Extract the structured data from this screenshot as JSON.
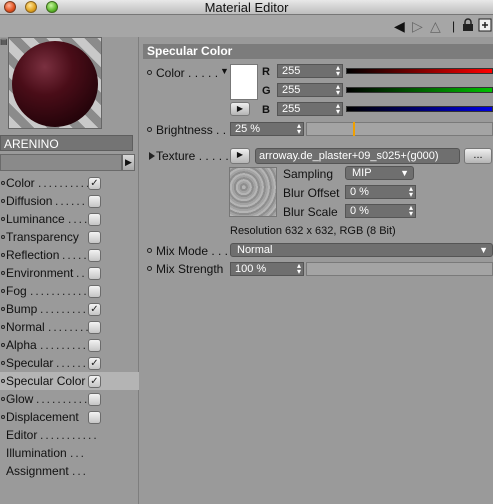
{
  "window": {
    "title": "Material Editor"
  },
  "toolbar": {
    "back_icon": "arrow-left-icon",
    "forward_icon": "arrow-right-icon",
    "up_icon": "arrow-up-icon",
    "lock_icon": "lock-icon",
    "new_icon": "new-panel-icon"
  },
  "material": {
    "name": "ARENINO",
    "accent": "#5a1320"
  },
  "channels": [
    {
      "label": "Color",
      "checked": true,
      "has_checkbox": true
    },
    {
      "label": "Diffusion",
      "checked": false,
      "has_checkbox": true
    },
    {
      "label": "Luminance",
      "checked": false,
      "has_checkbox": true
    },
    {
      "label": "Transparency",
      "checked": false,
      "has_checkbox": true
    },
    {
      "label": "Reflection",
      "checked": false,
      "has_checkbox": true
    },
    {
      "label": "Environment",
      "checked": false,
      "has_checkbox": true
    },
    {
      "label": "Fog",
      "checked": false,
      "has_checkbox": true
    },
    {
      "label": "Bump",
      "checked": true,
      "has_checkbox": true
    },
    {
      "label": "Normal",
      "checked": false,
      "has_checkbox": true
    },
    {
      "label": "Alpha",
      "checked": false,
      "has_checkbox": true
    },
    {
      "label": "Specular",
      "checked": true,
      "has_checkbox": true
    },
    {
      "label": "Specular Color",
      "checked": true,
      "has_checkbox": true,
      "active": true
    },
    {
      "label": "Glow",
      "checked": false,
      "has_checkbox": true
    },
    {
      "label": "Displacement",
      "checked": false,
      "has_checkbox": true
    },
    {
      "label": "Editor",
      "has_checkbox": false
    },
    {
      "label": "Illumination",
      "has_checkbox": false
    },
    {
      "label": "Assignment",
      "has_checkbox": false
    }
  ],
  "panel": {
    "section_title": "Specular Color",
    "color_label": "Color",
    "r_label": "R",
    "g_label": "G",
    "b_label": "B",
    "r_value": "255",
    "g_value": "255",
    "b_value": "255",
    "swatch_color": "#ffffff",
    "brightness_label": "Brightness",
    "brightness_value": "25 %",
    "brightness_level": 0.25,
    "texture_label": "Texture",
    "texture_value": "arroway.de_plaster+09_s025+(g000)",
    "texture_more": "...",
    "sampling_label": "Sampling",
    "sampling_value": "MIP",
    "blur_offset_label": "Blur Offset",
    "blur_offset_value": "0 %",
    "blur_scale_label": "Blur Scale",
    "blur_scale_value": "0 %",
    "resolution_text": "Resolution 632 x 632, RGB (8 Bit)",
    "mix_mode_label": "Mix Mode",
    "mix_mode_value": "Normal",
    "mix_strength_label": "Mix Strength",
    "mix_strength_value": "100 %"
  }
}
